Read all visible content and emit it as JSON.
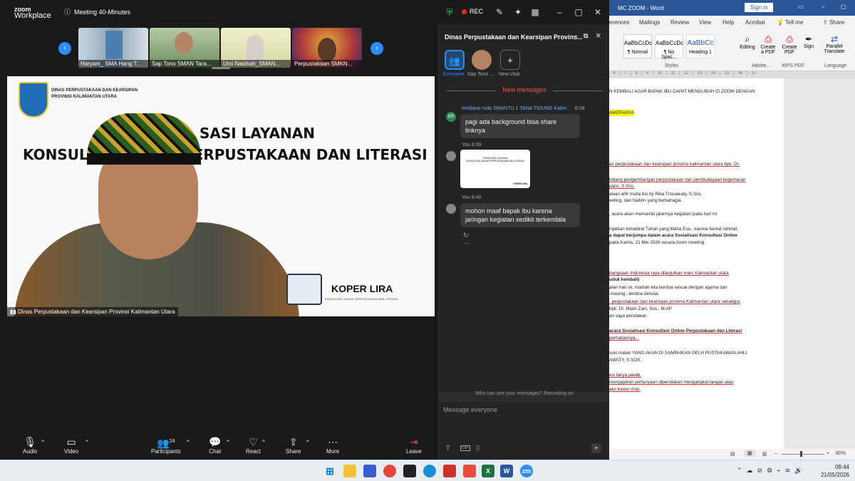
{
  "zoom": {
    "logo_line1": "zoom",
    "logo_line2": "Workplace",
    "meeting_label": "Meeting 40-Minutes",
    "rec_label": "REC",
    "participants_thumbs": [
      "Haryani_ SMA Hang T...",
      "Sap Tono SMAN Tara...",
      "Umi Nasihah_SMAN...",
      "Perpustakaan SMKN..."
    ],
    "stage": {
      "org_line1": "DINAS PERPUSTAKAAN DAN KEARSIPAN",
      "org_line2": "PROVINSI KALIMANTAN UTARA",
      "title_line1": "SASI LAYANAN",
      "title_line2_left": "KONSUL",
      "title_line2_right": "PERPUSTAKAAN DAN LITERASI",
      "brand": "KOPER LIRA",
      "brand_sub": "KONSULTASI ONLINE PERPUSTAKAAN DAN LITERASI",
      "speaker_name": "Dinas Perpustakaan dan Kearsipan Provinsi Kalimantan Utara"
    },
    "toolbar": {
      "audio": "Audio",
      "video": "Video",
      "participants": "Participants",
      "participants_count": "24",
      "chat": "Chat",
      "react": "React",
      "share": "Share",
      "more": "More",
      "leave": "Leave"
    }
  },
  "chat": {
    "title": "Dinas Perpustakaan dan Kearsipan Provins...",
    "tab_everyone": "Everyone",
    "tab_person": "Sap Tono ...",
    "tab_new": "New chat",
    "new_messages": "New messages",
    "messages": [
      {
        "sender": "emiliana ruda SMANTU 1 TANA TIDUNG Kalim...",
        "time": "8:28",
        "avatar": "ER",
        "text": "pagi ada background bisa share linknya"
      },
      {
        "sender": "You",
        "time": "8:39",
        "image_title": "SOSIALISASI LAYANAN",
        "image_sub": "KONSULTASI ONLINE PERPUSTAKAAN DAN LITERASI",
        "image_brand": "KOPER LIRA"
      },
      {
        "sender": "You",
        "time": "8:40",
        "text": "mohon maaf bapak ibu karena jaringan kegiatan sedikit terkendala"
      }
    ],
    "who_can_see": "Who can see your messages? Recording on",
    "placeholder": "Message everyone",
    "gif": "GIF"
  },
  "word": {
    "title": "MC ZOOM  -  Word",
    "sign_in": "Sign in",
    "tabs": [
      "erences",
      "Mailings",
      "Review",
      "View",
      "Help",
      "Acrobat",
      "Tell me",
      "Share"
    ],
    "styles": [
      "AaBbCcDc",
      "AaBbCcDc",
      "AaBbCc"
    ],
    "style_names": [
      "¶ Normal",
      "¶ No Spac...",
      "Heading 1"
    ],
    "styles_group": "Styles",
    "buttons": [
      "Editing",
      "Create a PDF",
      "Create PDF",
      "Sign",
      "Parallel Translate"
    ],
    "groups": [
      "Adobe...",
      "WPS PDF",
      "Language"
    ],
    "doc_lines": [
      "N KEMBALI AGAR BAPAK IBU DAPAT MENGUBAH ID ZOOM DENGAN",
      "AMERANYA",
      "as perpustakaan dan kearsipan provinsi kalimantan utara bpk. Dr.",
      "bidang pengembangan perpustakaan dan pembudayaan kegemaran",
      "paco, S.Sos.",
      "awan ahli muda ibu Aji Rika Trisnawaty, S.Sos.",
      "eeting, dan hadirin yang berbahagia.",
      ", acara akan memandu jalannya kegiatan pada hari ini",
      "injatkan kehadirat Tuhan yang Maha Esa , karena berkat rahmat,",
      "a dapat berjumpa dalam acara Sosialisasi Konsultasi Online",
      "pada Kamis, 21 Mei 2026 secara zoom meeting",
      "bangsaan Indonesia raya dilanjutkan mars Kalimantan utara",
      "uduk kembali)",
      "atan hari ini, marilah kita berdoa sesuai dengan agama dan",
      "-masing., berdoa dimulai",
      ", perpustakaan dan kearsipan provinsi Kalimantan utara sekaligus",
      "bpk. Dr. Ilham Zain, Sos., M.AP",
      "an saya persilakan.",
      "acara Sosialisasi Konsultasi Online Perpustakaan dan Literasi",
      "perhatiannya...",
      "suki materi YANG AKAN DI SAMPAIKAN OELH PUSTAKAWAN AHLI",
      "AWATY, S.SOS.",
      "esi tanya jawab.",
      "mengajukan pertanyaan dipersilakan mengangkat tangan atau",
      "alui kolom chat."
    ],
    "zoom_level": "80%"
  },
  "taskbar": {
    "time": "08:44",
    "date": "21/05/2026"
  }
}
